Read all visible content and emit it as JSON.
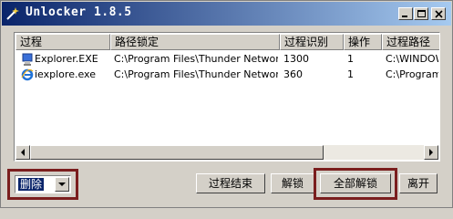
{
  "window": {
    "title": "Unlocker 1.8.5",
    "controls": {
      "minimize": "minimize-icon",
      "maximize": "maximize-icon",
      "close": "close-icon"
    }
  },
  "list": {
    "columns": [
      "过程",
      "路径锁定",
      "过程识别",
      "操作",
      "过程路径"
    ],
    "rows": [
      {
        "icon": "explorer-icon",
        "process": "Explorer.EXE",
        "path": "C:\\Program Files\\Thunder Networ...",
        "pid": "1300",
        "op": "1",
        "proc_path": "C:\\WINDOW"
      },
      {
        "icon": "ie-icon",
        "process": "iexplore.exe",
        "path": "C:\\Program Files\\Thunder Networ...",
        "pid": "360",
        "op": "1",
        "proc_path": "C:\\Program"
      }
    ]
  },
  "action_select": {
    "selected": "删除"
  },
  "buttons": {
    "kill": "过程结束",
    "unlock": "解锁",
    "unlock_all": "全部解锁",
    "quit": "离开"
  },
  "colors": {
    "highlight": "#7a1e1e",
    "titlebar_start": "#0a246a",
    "titlebar_end": "#a6caf0"
  }
}
